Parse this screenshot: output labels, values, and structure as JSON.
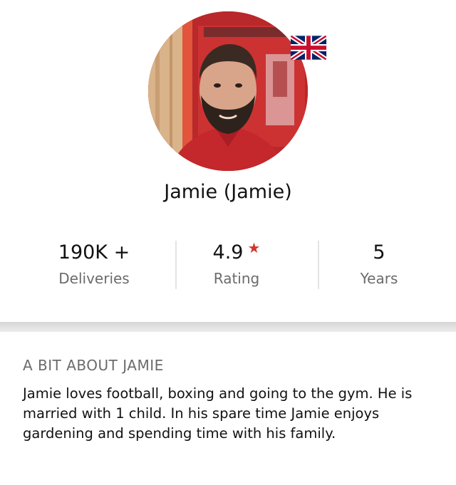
{
  "profile": {
    "name": "Jamie (Jamie)",
    "flag_icon": "uk-flag-icon",
    "avatar_icon": "driver-photo"
  },
  "stats": [
    {
      "value": "190K +",
      "label": "Deliveries"
    },
    {
      "value": "4.9",
      "label": "Rating",
      "icon": "star-icon"
    },
    {
      "value": "5",
      "label": "Years"
    }
  ],
  "about": {
    "heading": "A BIT ABOUT JAMIE",
    "text": "Jamie loves football, boxing and going to the gym. He is married with 1 child. In his spare time Jamie enjoys gardening and spending time with his family."
  },
  "colors": {
    "star": "#d0352f",
    "label_grey": "#6b6b6b",
    "text": "#111111"
  }
}
